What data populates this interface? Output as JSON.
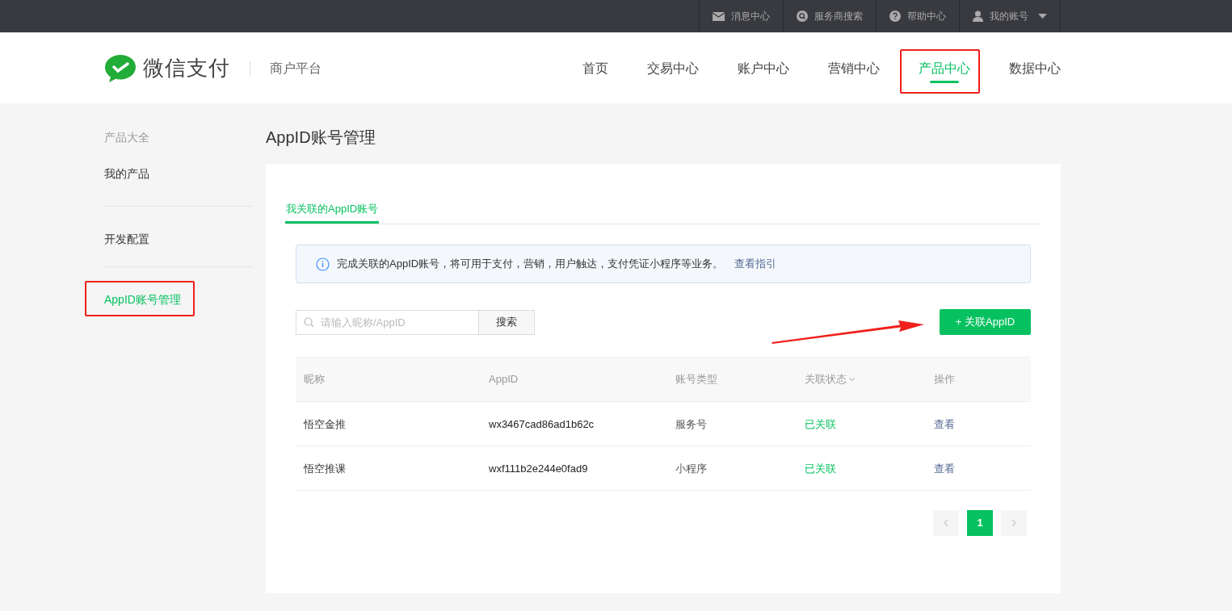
{
  "top_bar": {
    "items": [
      {
        "kind": "mail",
        "label": "消息中心"
      },
      {
        "kind": "search",
        "label": "服务商搜索"
      },
      {
        "kind": "help",
        "label": "帮助中心"
      },
      {
        "kind": "account",
        "label": "我的账号"
      }
    ]
  },
  "header": {
    "logo_text": "微信支付",
    "subtitle": "商户平台",
    "nav": [
      {
        "label": "首页",
        "selected": false
      },
      {
        "label": "交易中心",
        "selected": false
      },
      {
        "label": "账户中心",
        "selected": false
      },
      {
        "label": "营销中心",
        "selected": false
      },
      {
        "label": "产品中心",
        "selected": true
      },
      {
        "label": "数据中心",
        "selected": false
      }
    ]
  },
  "sidebar": {
    "groups": [
      {
        "heading": "产品大全",
        "items": [
          {
            "label": "我的产品",
            "selected": false
          }
        ]
      },
      {
        "items": [
          {
            "label": "开发配置",
            "selected": false
          }
        ]
      },
      {
        "items": [
          {
            "label": "AppID账号管理",
            "selected": true
          }
        ]
      }
    ]
  },
  "page_title": "AppID账号管理",
  "tabs": [
    {
      "label": "我关联的AppID账号",
      "selected": true
    }
  ],
  "notice": {
    "text": "完成关联的AppID账号，将可用于支付，营销，用户触达，支付凭证小程序等业务。",
    "link": "查看指引"
  },
  "search": {
    "placeholder": "请输入昵称/AppID",
    "button": "搜索"
  },
  "add_button": "+ 关联AppID",
  "table": {
    "columns": [
      {
        "label": "昵称",
        "sortable": false
      },
      {
        "label": "AppID",
        "sortable": false
      },
      {
        "label": "账号类型",
        "sortable": false
      },
      {
        "label": "关联状态",
        "sortable": true
      },
      {
        "label": "操作",
        "sortable": false
      }
    ],
    "rows": [
      {
        "nickname": "悟空金推",
        "appid": "wx3467cad86ad1b62c",
        "type": "服务号",
        "status": "已关联",
        "action": "查看"
      },
      {
        "nickname": "悟空推课",
        "appid": "wxf111b2e244e0fad9",
        "type": "小程序",
        "status": "已关联",
        "action": "查看"
      }
    ]
  },
  "pagination": {
    "prev_disabled": true,
    "next_disabled": true,
    "pages": [
      {
        "label": "1",
        "selected": true
      }
    ]
  }
}
